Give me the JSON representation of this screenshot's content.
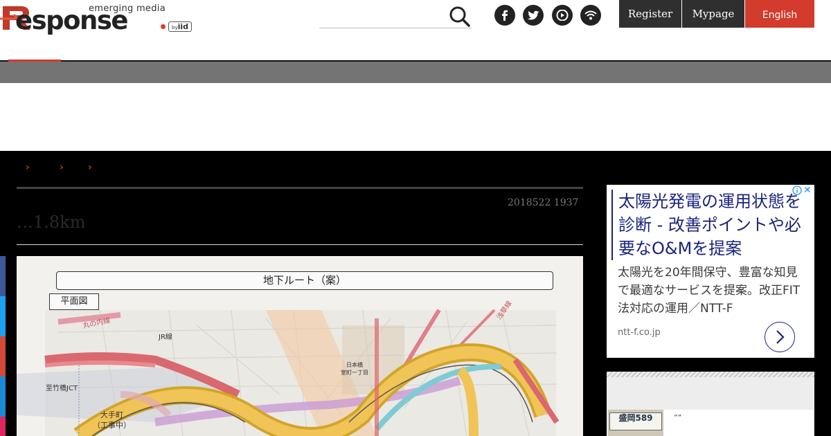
{
  "header": {
    "logo_tagline": "emerging media",
    "logo_word": "esponse",
    "logo_by_prefix": "by",
    "logo_by_name": "iid",
    "register_label": "Register",
    "mypage_label": "Mypage",
    "english_label": "English",
    "social_icons": [
      "facebook-icon",
      "twitter-icon",
      "youtube-icon",
      "rss-icon"
    ],
    "accent_color": "#d33b2c"
  },
  "breadcrumb": {
    "separators": [
      "›",
      "›",
      "›"
    ]
  },
  "article": {
    "date": "2018522 1937",
    "title": "…1.8km"
  },
  "map": {
    "title": "地下ルート（案）",
    "plan_label": "平面図",
    "labels": {
      "marunouchi": "丸の内線",
      "jr": "JR線",
      "asakusa": "浅草線",
      "nihonbashi": "日本橋\n室町一丁目",
      "takebashi": "至竹橋JCT",
      "otemachi": "大手町\n（工事中）"
    }
  },
  "ad": {
    "headline": "太陽光発電の運用状態を診断 - 改善ポイントや必要なO&Mを提案",
    "description": "太陽光を20年間保守、豊富な知見で最適なサービスを提案。改正FIT法対応の運用／NTT-F",
    "domain": "ntt-f.co.jp",
    "close_glyph": "✕"
  },
  "widget2": {
    "quote": "“”",
    "plate_text": "盛岡589"
  }
}
